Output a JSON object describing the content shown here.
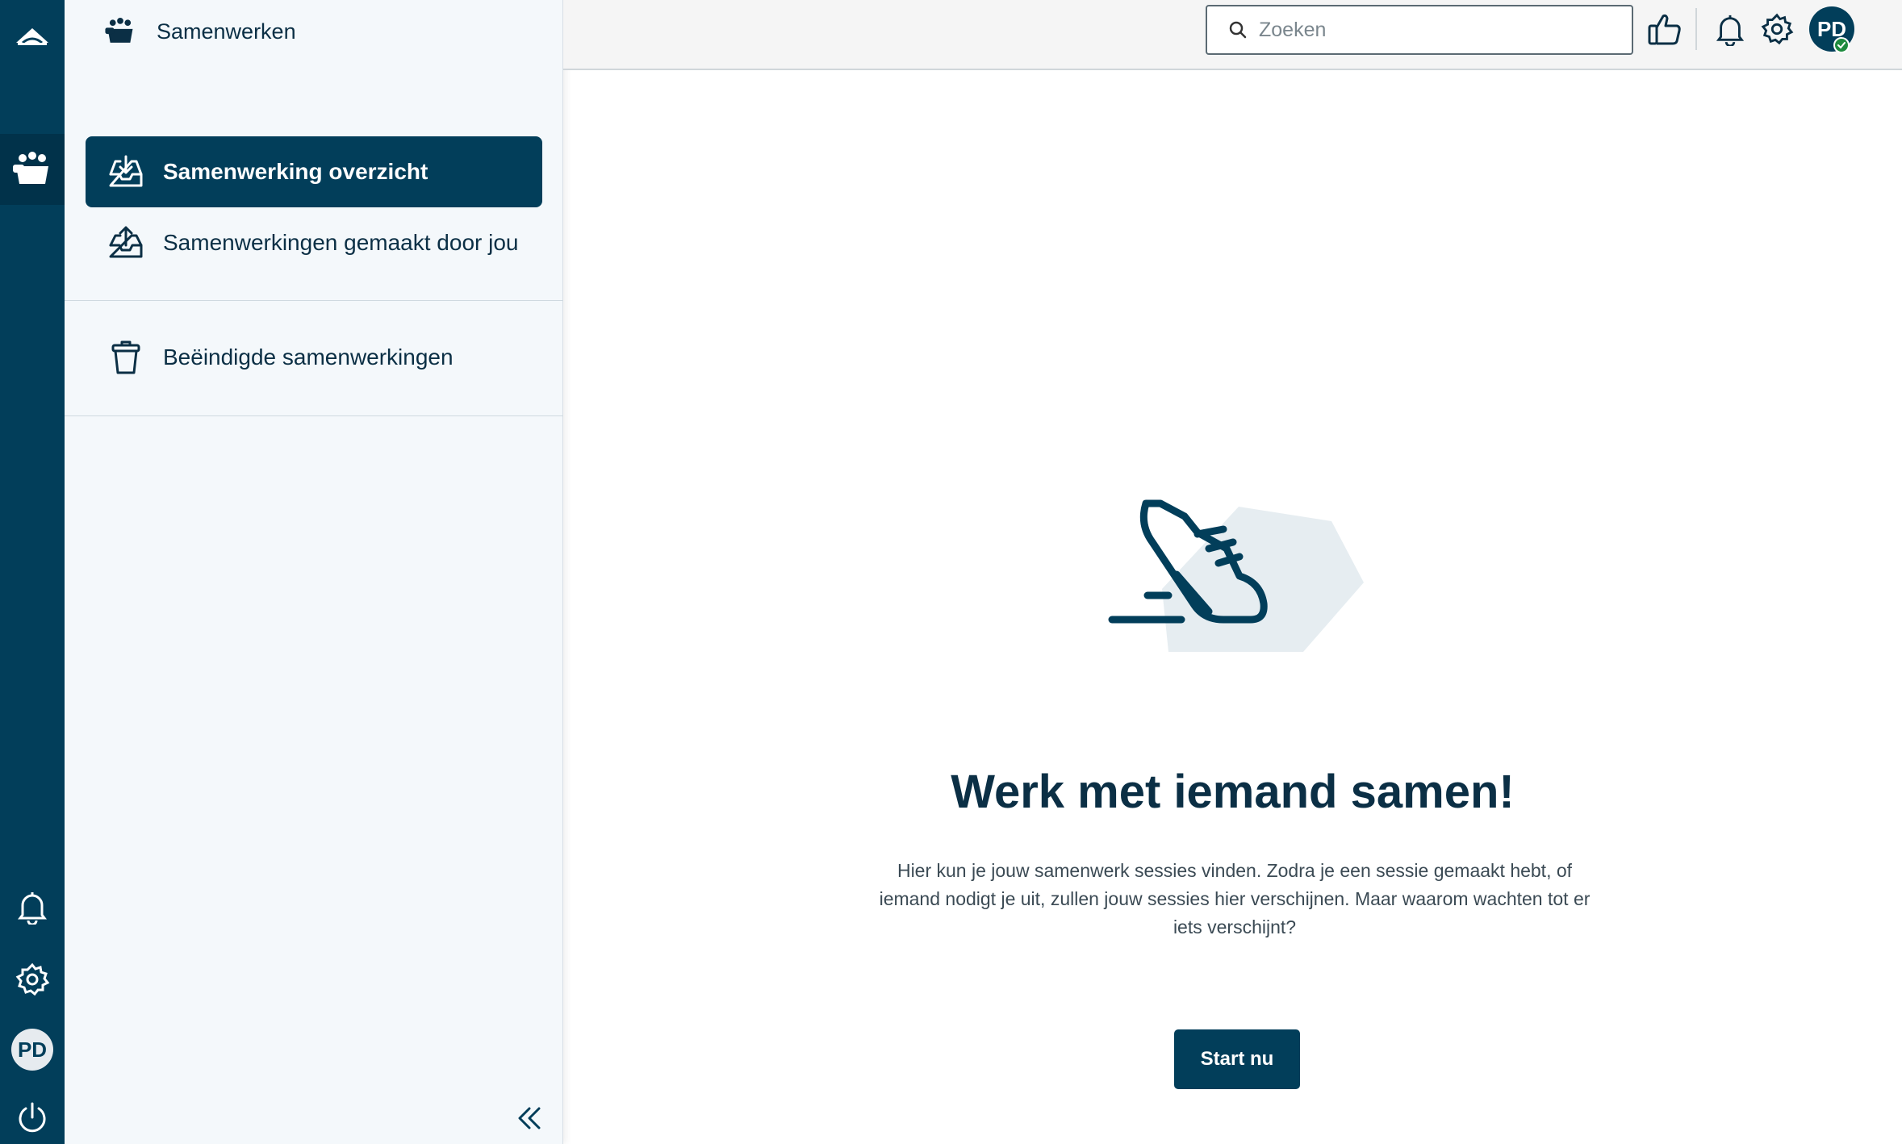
{
  "rail": {
    "items": [
      {
        "name": "logo",
        "icon": "cloud-logo-icon"
      },
      {
        "name": "collaborate",
        "icon": "people-group-icon",
        "active": true
      },
      {
        "name": "notifications",
        "icon": "bell-icon"
      },
      {
        "name": "settings",
        "icon": "gear-icon"
      },
      {
        "name": "profile",
        "icon": "avatar"
      },
      {
        "name": "logout",
        "icon": "power-icon"
      }
    ],
    "avatar_initials": "PD"
  },
  "panel": {
    "header": "Samenwerken",
    "items": [
      {
        "label": "Samenwerking overzicht",
        "icon": "inbox-download-icon",
        "active": true
      },
      {
        "label": "Samenwerkingen gemaakt door jou",
        "icon": "inbox-upload-icon",
        "active": false
      },
      {
        "label": "Beëindigde samenwerkingen",
        "icon": "trash-icon",
        "active": false
      }
    ]
  },
  "topbar": {
    "search_placeholder": "Zoeken",
    "avatar_initials": "PD",
    "status": "online"
  },
  "main": {
    "title": "Werk met iemand samen!",
    "description": "Hier kun je jouw samenwerk sessies vinden. Zodra je een sessie gemaakt hebt, of iemand nodigt je uit, zullen jouw sessies hier verschijnen. Maar waarom wachten tot er iets verschijnt?",
    "cta_label": "Start nu",
    "illustration": "running-shoe-icon"
  },
  "colors": {
    "primary": "#023e5a",
    "text": "#0b2f45",
    "panel_bg": "#f4f8fb",
    "status_online": "#1e8a3e"
  }
}
